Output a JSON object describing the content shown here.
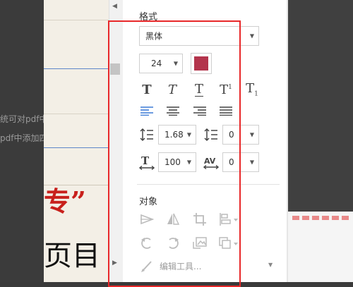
{
  "left_snippets": [
    "统可对pdf中",
    "pdf中添加四"
  ],
  "doc": {
    "red_text": "专”",
    "black_text": "页目"
  },
  "panel": {
    "format_title": "格式",
    "font_name": "黑体",
    "font_size": "24",
    "font_color": "#b3344c",
    "line_spacing": "1.68",
    "paragraph_spacing": "0",
    "char_scale": "100",
    "char_spacing": "0",
    "object_title": "对象",
    "edit_tools_label": "编辑工具..."
  }
}
